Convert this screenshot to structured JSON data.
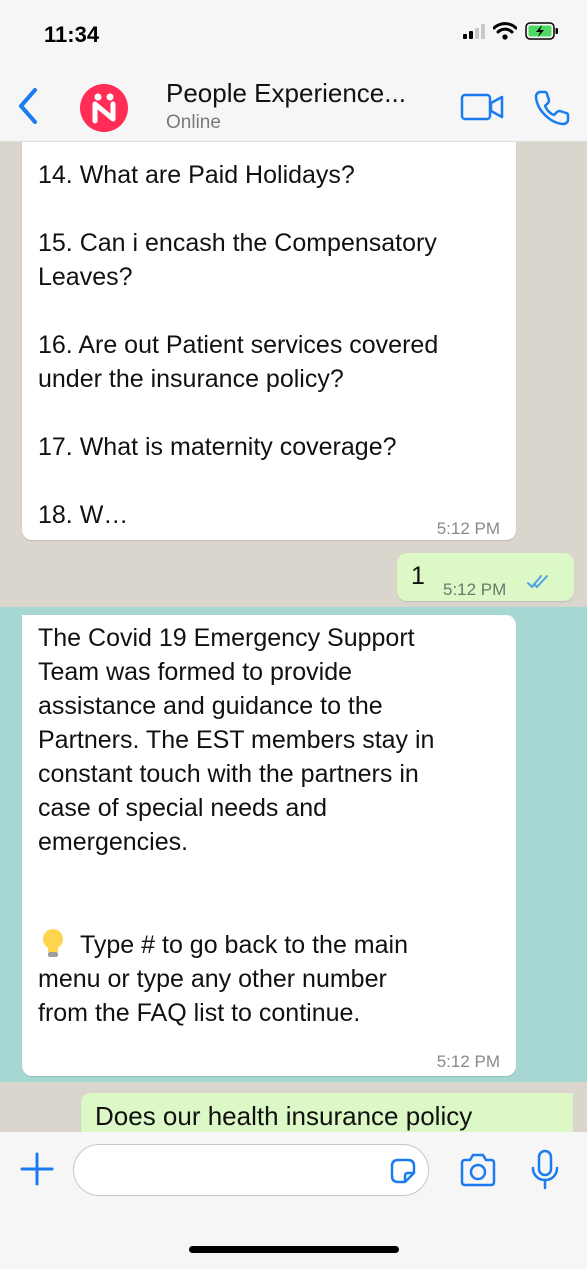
{
  "status_bar": {
    "time": "11:34",
    "battery": "charging"
  },
  "header": {
    "contact_name": "People Experience...",
    "contact_status": "Online",
    "icons": {
      "back": "chevron-left-icon",
      "video": "video-camera-icon",
      "call": "phone-icon"
    },
    "accent_color": "#1a7cf0",
    "avatar_color": "#ff2d55"
  },
  "messages": [
    {
      "direction": "incoming",
      "lines": [
        "14. What are Paid Holidays?",
        "15. Can i encash the Compensatory",
        "Leaves?",
        "16. Are out Patient services covered",
        "under the insurance policy?",
        "17. What is maternity coverage?",
        "18. W…"
      ],
      "time": "5:12 PM"
    },
    {
      "direction": "outgoing",
      "text": "1",
      "time": "5:12 PM",
      "status": "read"
    },
    {
      "direction": "incoming",
      "paragraph_lines": [
        "The Covid 19 Emergency Support",
        "Team was formed to provide",
        "assistance and guidance to the",
        "Partners. The EST members stay in",
        "constant touch with the partners in",
        "case of special needs and",
        "emergencies."
      ],
      "tip_lines": [
        "Type # to go back to the main",
        "menu or type any other number",
        "from the FAQ list to continue."
      ],
      "tip_icon": "lightbulb-icon",
      "time": "5:12 PM"
    },
    {
      "direction": "outgoing",
      "text": "Does our health insurance policy"
    }
  ],
  "colors": {
    "outgoing_bubble": "#dcf8c6",
    "incoming_bubble": "#ffffff",
    "highlight_band": "#a6d7d3",
    "chat_background": "#dad6ce"
  },
  "compose": {
    "placeholder": "",
    "icons": {
      "plus": "plus-icon",
      "sticker": "sticker-icon",
      "camera": "camera-icon",
      "mic": "microphone-icon"
    }
  }
}
